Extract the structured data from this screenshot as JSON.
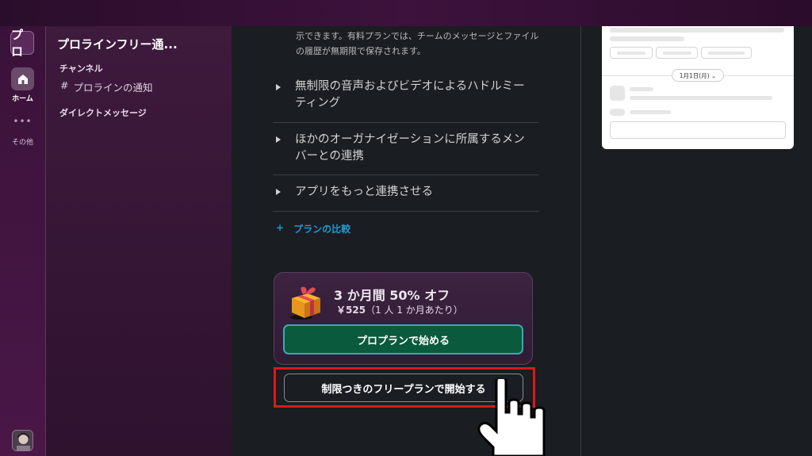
{
  "rail": {
    "workspace_initial": "プロ",
    "home_label": "ホーム",
    "more_dots": "•••",
    "other_label": "その他"
  },
  "sidebar": {
    "workspace_name": "プロラインフリー通...",
    "channels_heading": "チャンネル",
    "channel_hash": "#",
    "channel_name": "プロラインの通知",
    "dm_heading": "ダイレクトメッセージ"
  },
  "main": {
    "description": "示できます。有料プランでは、チームのメッセージとファイルの履歴が無期限で保存されます。",
    "features": [
      {
        "label": "無制限の音声およびビデオによるハドルミーティング"
      },
      {
        "label": "ほかのオーガナイゼーションに所属するメンバーとの連携"
      },
      {
        "label": "アプリをもっと連携させる"
      }
    ],
    "compare_plus": "+",
    "compare_label": "プランの比較",
    "promo": {
      "title": "3 か月間 50% オフ",
      "price": "￥525",
      "price_note": "（1 人 1 か月あたり）",
      "pro_button": "プロプランで始める"
    },
    "free_button": "制限つきのフリープランで開始する"
  },
  "preview": {
    "date_pill": "1月1日(月) ⌄"
  },
  "colors": {
    "accent_link": "#1d9bd1",
    "pro_button_bg": "#0a5a3d",
    "highlight": "#e0161b"
  }
}
